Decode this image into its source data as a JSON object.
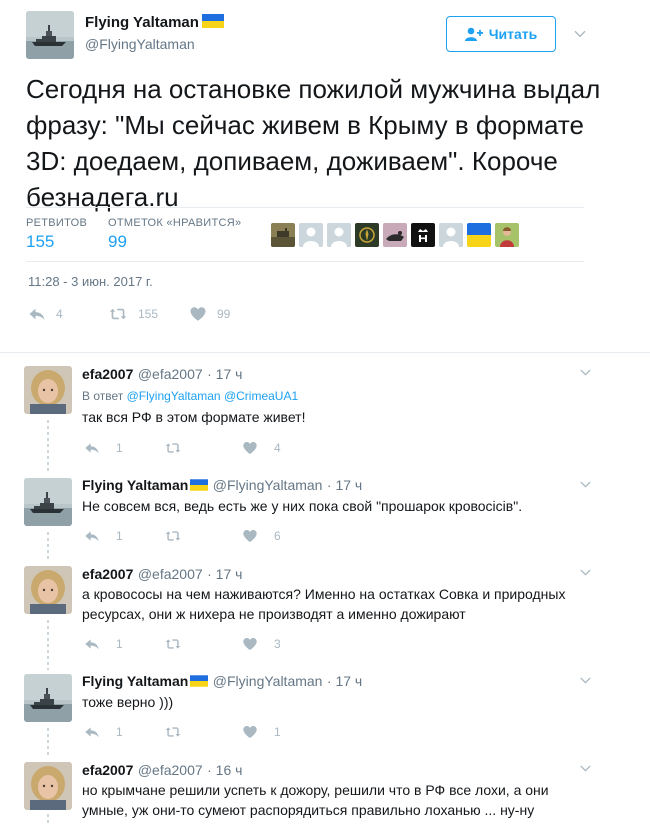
{
  "tweet": {
    "author_name": "Flying Yaltaman",
    "author_handle": "@FlyingYaltaman",
    "follow_label": "Читать",
    "text": "Сегодня на остановке пожилой мужчина выдал фразу: \"Мы сейчас живем в Крыму в формате 3D: доедаем, допиваем, доживаем\". Короче безнадега.ru",
    "retweets_label": "РЕТВИТОВ",
    "retweets_count": "155",
    "likes_label": "ОТМЕТОК «НРАВИТСЯ»",
    "likes_count": "99",
    "timestamp": "11:28 - 3 июн. 2017 г.",
    "actions": {
      "reply": "4",
      "retweet": "155",
      "like": "99"
    }
  },
  "replies": [
    {
      "name": "efa2007",
      "handle": "@efa2007",
      "time": "· 17 ч",
      "reply_to_prefix": "В ответ",
      "reply_to_1": "@FlyingYaltaman",
      "reply_to_2": "@CrimeaUA1",
      "line1": "так вся РФ в этом формате живет!",
      "line2": "",
      "reply": "1",
      "retweet": "",
      "like": "4"
    },
    {
      "name": "Flying Yaltaman",
      "handle": "@FlyingYaltaman",
      "time": "· 17 ч",
      "line1": "Не совсем вся, ведь есть же у них пока свой \"прошарок кровосісів\".",
      "line2": "",
      "reply": "1",
      "retweet": "",
      "like": "6"
    },
    {
      "name": "efa2007",
      "handle": "@efa2007",
      "time": "· 17 ч",
      "line1": "а кровососы на чем наживаются? Именно на остатках Совка и  природных",
      "line2": "ресурсах, они ж нихера не производят а именно дожирают",
      "reply": "1",
      "retweet": "",
      "like": "3"
    },
    {
      "name": "Flying Yaltaman",
      "handle": "@FlyingYaltaman",
      "time": "· 17 ч",
      "line1": "тоже верно )))",
      "line2": "",
      "reply": "1",
      "retweet": "",
      "like": "1"
    },
    {
      "name": "efa2007",
      "handle": "@efa2007",
      "time": "· 16 ч",
      "line1": "но крымчане решили успеть к дожору, решили что в РФ все лохи, а они",
      "line2": "умные, уж они-то сумеют распорядиться правильно лоханью ... ну-ну",
      "reply": "",
      "retweet": "",
      "like": ""
    }
  ],
  "icons": {
    "follow": "add-user-icon",
    "more": "chevron-down-icon",
    "reply": "reply-icon",
    "retweet": "retweet-icon",
    "like": "heart-icon"
  },
  "colors": {
    "accent": "#1da1f2",
    "muted": "#657786",
    "icon": "#aab8c2",
    "divider": "#e6ecf0"
  }
}
